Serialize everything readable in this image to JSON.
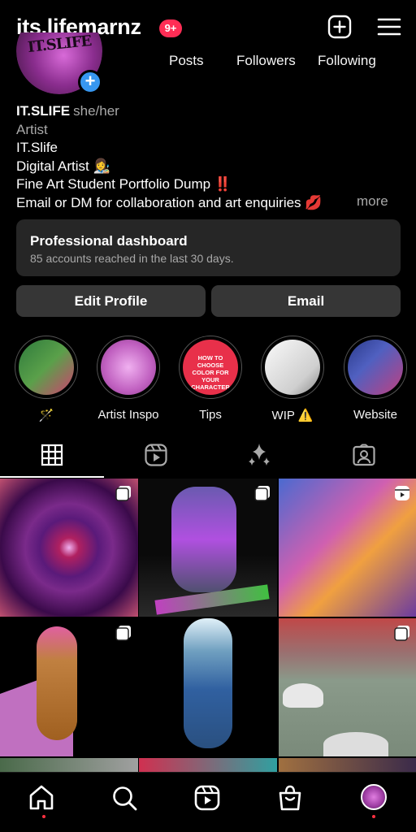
{
  "header": {
    "username": "its.lifemarnz",
    "notification_count": "9+",
    "create_icon": "plus-square-icon",
    "menu_icon": "hamburger-menu-icon"
  },
  "profile": {
    "avatar_text": "IT.SLIFE",
    "stats": {
      "posts_label": "Posts",
      "followers_label": "Followers",
      "following_label": "Following"
    }
  },
  "bio": {
    "name": "IT.SLIFE",
    "pronouns": "she/her",
    "category": "Artist",
    "lines": [
      "IT.Slife",
      "Digital Artist 👩‍🎨",
      "Fine Art Student Portfolio Dump ‼️",
      "Email or DM for collaboration and art enquiries 💋"
    ],
    "more_label": "more"
  },
  "dashboard": {
    "title": "Professional dashboard",
    "subtitle": "85 accounts reached in the last 30 days."
  },
  "buttons": {
    "edit_profile": "Edit Profile",
    "email": "Email"
  },
  "highlights": [
    {
      "label": "🪄",
      "colors": [
        "#2e7a3c",
        "#d04070"
      ]
    },
    {
      "label": "Artist Inspo",
      "colors": [
        "#e8a0e8",
        "#b050b0"
      ]
    },
    {
      "label": "Tips",
      "colors": [
        "#e8304a",
        "#e8304a"
      ],
      "cover_text": "HOW TO CHOOSE COLOR FOR YOUR CHARACTER"
    },
    {
      "label": "WIP ⚠️",
      "colors": [
        "#f0f0f0",
        "#999999"
      ]
    },
    {
      "label": "Website",
      "colors": [
        "#2a3a8a",
        "#c04080"
      ]
    }
  ],
  "tabs": [
    {
      "name": "grid",
      "icon": "grid-icon",
      "active": true
    },
    {
      "name": "reels",
      "icon": "reels-icon",
      "active": false
    },
    {
      "name": "collabs",
      "icon": "sparkles-icon",
      "active": false
    },
    {
      "name": "tagged",
      "icon": "tagged-person-icon",
      "active": false
    }
  ],
  "posts": [
    {
      "type": "carousel",
      "colors": [
        "#5a1a7a",
        "#c03040"
      ]
    },
    {
      "type": "carousel",
      "colors": [
        "#101010",
        "#a040c0"
      ]
    },
    {
      "type": "reel",
      "colors": [
        "#6a3aa0",
        "#e070c0"
      ]
    },
    {
      "type": "carousel",
      "colors": [
        "#000000",
        "#c060c0"
      ]
    },
    {
      "type": "none",
      "colors": [
        "#000000",
        "#3060a0"
      ]
    },
    {
      "type": "carousel",
      "colors": [
        "#8a9a8a",
        "#d04040"
      ]
    }
  ],
  "nav": [
    {
      "name": "home",
      "icon": "home-icon",
      "dot": true
    },
    {
      "name": "search",
      "icon": "search-icon",
      "dot": false
    },
    {
      "name": "reels",
      "icon": "reels-icon",
      "dot": false
    },
    {
      "name": "shop",
      "icon": "shopping-bag-icon",
      "dot": false
    },
    {
      "name": "profile",
      "icon": "profile-avatar-icon",
      "dot": true
    }
  ]
}
